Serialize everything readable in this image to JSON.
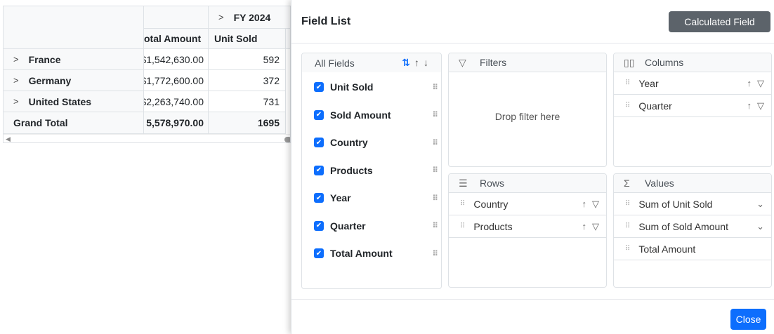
{
  "pivot": {
    "year_header": "FY 2024",
    "columns": [
      "Total Amount",
      "Unit Sold"
    ],
    "total_amount_visible": "otal Amount",
    "rows": [
      {
        "label": "France",
        "total": "$1,542,630.00",
        "units": "592"
      },
      {
        "label": "Germany",
        "total": "$1,772,600.00",
        "units": "372"
      },
      {
        "label": "United States",
        "total": "$2,263,740.00",
        "units": "731"
      }
    ],
    "grand_total": {
      "label": "Grand Total",
      "total": "5,578,970.00",
      "units": "1695"
    }
  },
  "dialog": {
    "title": "Field List",
    "calculated_field": "Calculated Field",
    "close": "Close",
    "all_fields": {
      "label": "All Fields",
      "fields": [
        "Unit Sold",
        "Sold Amount",
        "Country",
        "Products",
        "Year",
        "Quarter",
        "Total Amount"
      ]
    },
    "filters": {
      "label": "Filters",
      "placeholder": "Drop filter here"
    },
    "columns": {
      "label": "Columns",
      "items": [
        "Year",
        "Quarter"
      ]
    },
    "rows": {
      "label": "Rows",
      "items": [
        "Country",
        "Products"
      ]
    },
    "values": {
      "label": "Values",
      "items": [
        "Sum of Unit Sold",
        "Sum of Sold Amount",
        "Total Amount"
      ]
    }
  },
  "colors": {
    "primary": "#0d6efd",
    "secondary": "#5c636a"
  }
}
